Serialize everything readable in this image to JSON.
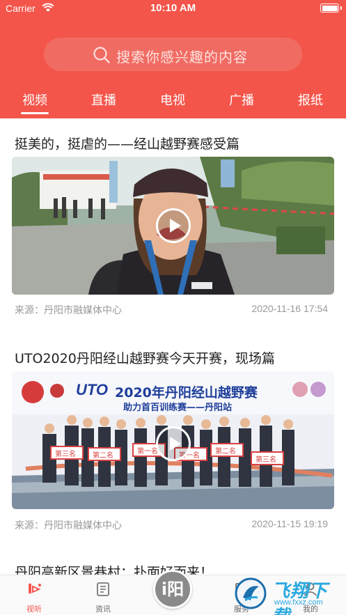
{
  "status_bar": {
    "carrier": "Carrier",
    "time": "10:10 AM"
  },
  "search": {
    "placeholder": "搜索你感兴趣的内容"
  },
  "tabs": [
    {
      "label": "视频",
      "active": true
    },
    {
      "label": "直播",
      "active": false
    },
    {
      "label": "电视",
      "active": false
    },
    {
      "label": "广播",
      "active": false
    },
    {
      "label": "报纸",
      "active": false
    }
  ],
  "articles": [
    {
      "title": "挺美的，挺虐的——经山越野赛感受篇",
      "source": "来源：丹阳市融媒体中心",
      "time": "2020-11-16 17:54"
    },
    {
      "title": "UTO2020丹阳经山越野赛今天开赛，现场篇",
      "source": "来源：丹阳市融媒体中心",
      "time": "2020-11-15 19:19",
      "banner": {
        "brand": "UTO",
        "headline": "2020年丹阳经山越野赛",
        "subline": "助力首百训练赛——丹阳站"
      },
      "placards": [
        "第三名",
        "第二名",
        "第一名",
        "第一名",
        "第二名",
        "第三名"
      ]
    },
    {
      "title": "丹阳高新区景巷村：扑面好而来！"
    }
  ],
  "tabbar": {
    "items": [
      {
        "label": "视听",
        "icon": "video-tab-icon",
        "active": true
      },
      {
        "label": "资讯",
        "icon": "news-tab-icon",
        "active": false
      },
      {
        "label": "服务",
        "icon": "service-tab-icon",
        "active": false
      },
      {
        "label": "我的",
        "icon": "profile-tab-icon",
        "active": false
      }
    ],
    "center_label": "i阳"
  },
  "watermark": {
    "text": "飞翔下载",
    "url": "www.fxxz.com"
  },
  "colors": {
    "brand": "#f4554a",
    "meta": "#999999"
  }
}
